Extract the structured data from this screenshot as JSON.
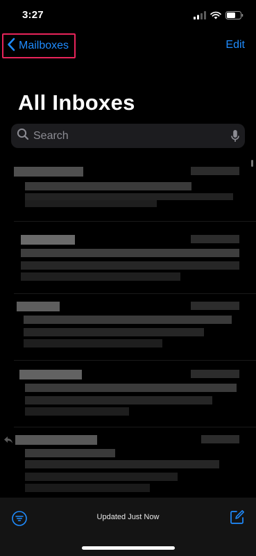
{
  "status_bar": {
    "time": "3:27",
    "icons": [
      "cellular-signal-icon",
      "wifi-icon",
      "battery-icon"
    ]
  },
  "nav": {
    "back_label": "Mailboxes",
    "edit_label": "Edit"
  },
  "page": {
    "title": "All Inboxes"
  },
  "search": {
    "placeholder": "Search"
  },
  "mail_list": {
    "note_visible": "message rows are pixelated / obscured",
    "rows": 5
  },
  "toolbar": {
    "status": "Updated Just Now",
    "icons": [
      "filter-icon",
      "compose-icon"
    ]
  },
  "colors": {
    "accent": "#1f8cff",
    "highlight": "#e8245a",
    "background": "#000000",
    "search_bg": "#1c1c1f",
    "toolbar_bg": "#141414"
  }
}
